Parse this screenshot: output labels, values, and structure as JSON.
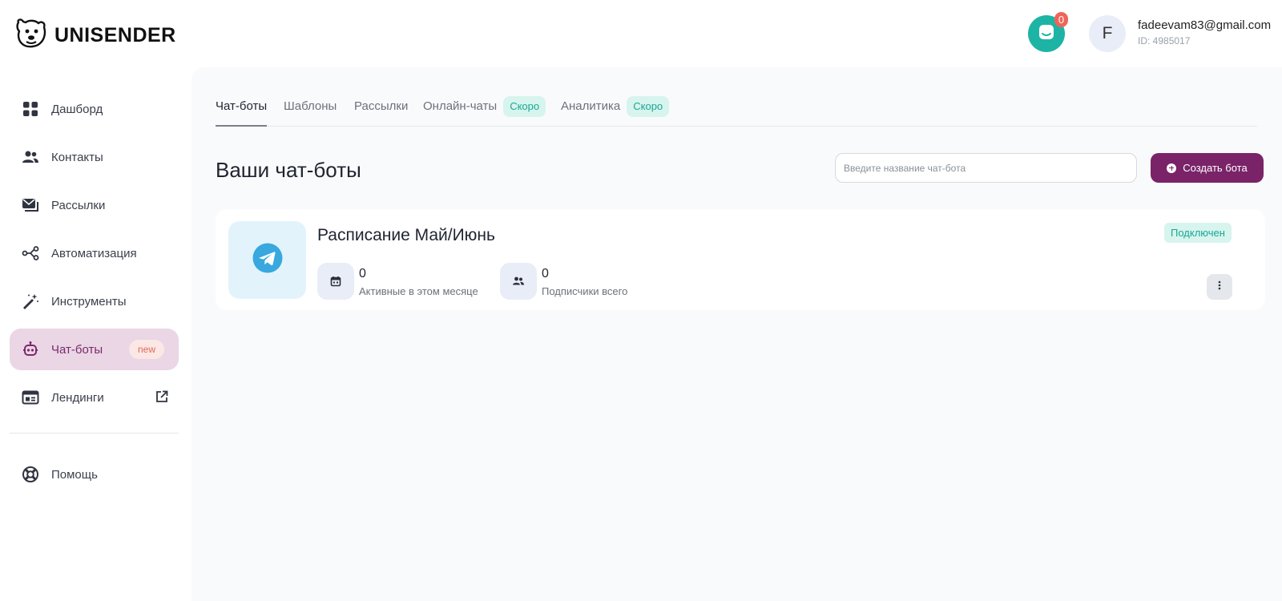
{
  "brand": {
    "name": "UNISENDER"
  },
  "header": {
    "chat_count": "0",
    "avatar_letter": "F",
    "email": "fadeevam83@gmail.com",
    "user_id": "ID: 4985017"
  },
  "sidebar": {
    "items": [
      {
        "label": "Дашборд",
        "icon": "grid-icon"
      },
      {
        "label": "Контакты",
        "icon": "users-icon"
      },
      {
        "label": "Рассылки",
        "icon": "mail-icon"
      },
      {
        "label": "Автоматизация",
        "icon": "share-nodes-icon"
      },
      {
        "label": "Инструменты",
        "icon": "magic-wand-icon"
      },
      {
        "label": "Чат-боты",
        "icon": "robot-icon",
        "badge": "new",
        "active": true
      },
      {
        "label": "Лендинги",
        "icon": "landing-page-icon",
        "external": true
      }
    ],
    "help_label": "Помощь"
  },
  "tabs": [
    {
      "label": "Чат-боты",
      "active": true
    },
    {
      "label": "Шаблоны"
    },
    {
      "label": "Рассылки"
    },
    {
      "label": "Онлайн-чаты",
      "badge": "Скоро"
    },
    {
      "label": "Аналитика",
      "badge": "Скоро"
    }
  ],
  "main": {
    "title": "Ваши чат-боты",
    "search_placeholder": "Введите название чат-бота",
    "create_button": "Создать бота"
  },
  "bot": {
    "name": "Расписание Май/Июнь",
    "platform_icon": "telegram-icon",
    "status": "Подключен",
    "stats": [
      {
        "value": "0",
        "label": "Активные в этом месяце",
        "icon": "calendar-icon"
      },
      {
        "value": "0",
        "label": "Подписчики всего",
        "icon": "users-icon"
      }
    ]
  },
  "colors": {
    "accent": "#7a2368",
    "teal": "#1db4a5",
    "badge_red": "#f0635a",
    "active_nav_bg": "#ead6e5",
    "soon_bg": "#d7f4ee"
  }
}
